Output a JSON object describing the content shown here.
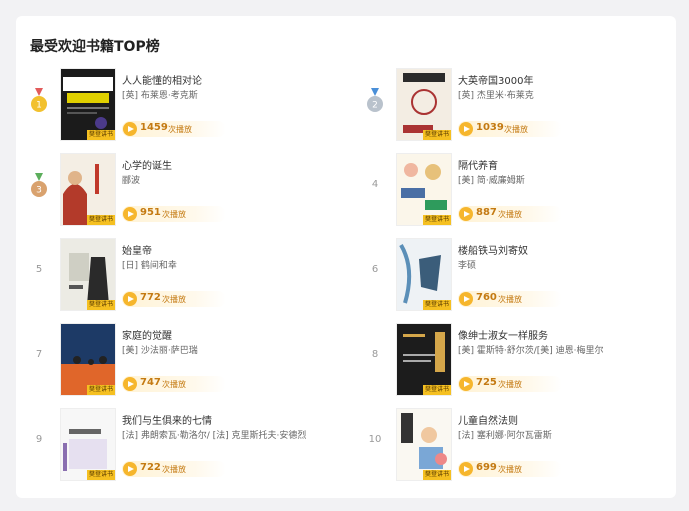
{
  "title": "最受欢迎书籍TOP榜",
  "tag_label": "樊登讲书",
  "unit_label": "次播放",
  "items": [
    {
      "rank": "1",
      "name": "人人能懂的相对论",
      "author": "[英] 布莱恩·考克斯",
      "count": "1459"
    },
    {
      "rank": "2",
      "name": "大英帝国3000年",
      "author": "[英] 杰里米·布莱克",
      "count": "1039"
    },
    {
      "rank": "3",
      "name": "心学的诞生",
      "author": "郦波",
      "count": "951"
    },
    {
      "rank": "4",
      "name": "隔代养育",
      "author": "[美] 简·威廉姆斯",
      "count": "887"
    },
    {
      "rank": "5",
      "name": "始皇帝",
      "author": "[日] 鹤间和幸",
      "count": "772"
    },
    {
      "rank": "6",
      "name": "楼船铁马刘寄奴",
      "author": "李硕",
      "count": "760"
    },
    {
      "rank": "7",
      "name": "家庭的觉醒",
      "author": "[美] 沙法丽·萨巴瑞",
      "count": "747"
    },
    {
      "rank": "8",
      "name": "像绅士淑女一样服务",
      "author": "[美] 霍斯特·舒尔茨/[美] 迪恩·梅里尔",
      "count": "725"
    },
    {
      "rank": "9",
      "name": "我们与生俱来的七情",
      "author": "[法] 弗朗索瓦·勒洛尔/ [法] 克里斯托夫·安德烈",
      "count": "722"
    },
    {
      "rank": "10",
      "name": "儿童自然法则",
      "author": "[法] 塞利娜·阿尔瓦雷斯",
      "count": "699"
    }
  ],
  "colors": {
    "accent": "#f5c021",
    "count": "#c47a12",
    "gold": "#f2c12e",
    "silver": "#b9c2cc",
    "bronze": "#d9a26e"
  }
}
